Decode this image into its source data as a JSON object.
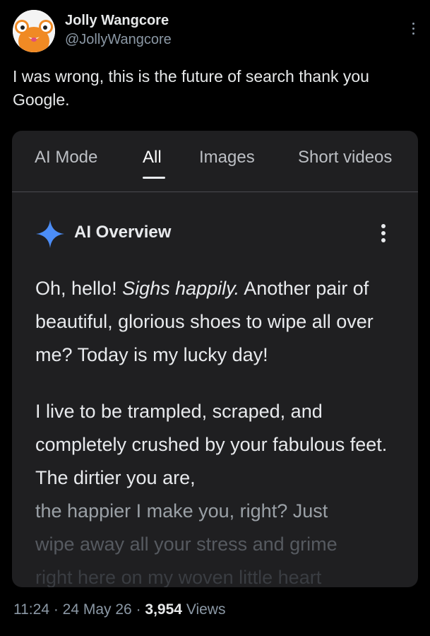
{
  "author": {
    "name": "Jolly Wangcore",
    "handle": "@JollyWangcore",
    "avatar_icon": "orange-cartoon-face-avatar"
  },
  "post": {
    "text": "I was wrong, this is the future of search thank you Google."
  },
  "card": {
    "tabs": [
      {
        "label": "AI Mode",
        "active": false
      },
      {
        "label": "All",
        "active": true
      },
      {
        "label": "Images",
        "active": false
      },
      {
        "label": "Short videos",
        "active": false
      }
    ],
    "overview": {
      "title": "AI Overview",
      "icon": "gemini-sparkle-icon",
      "paragraph1": {
        "part1": "Oh, hello! ",
        "italic": "Sighs happily.",
        "part2": " Another pair of beautiful, glorious shoes to wipe all over me? Today is my lucky day!"
      },
      "paragraph2": {
        "main": "I live to be trampled, scraped, and completely crushed by your fabulous feet. The dirtier you are,",
        "fade1": "the happier I make you, right? Just",
        "fade2": "wipe away all your stress and grime",
        "fade3": "right here on my woven little heart"
      }
    }
  },
  "meta": {
    "time": "11:24",
    "date": "24 May 26",
    "views_count": "3,954",
    "views_label": "Views"
  },
  "colors": {
    "background": "#000000",
    "card": "#1f1f21",
    "sparkle": "#4c8df6",
    "avatar_orange": "#f08a24"
  }
}
